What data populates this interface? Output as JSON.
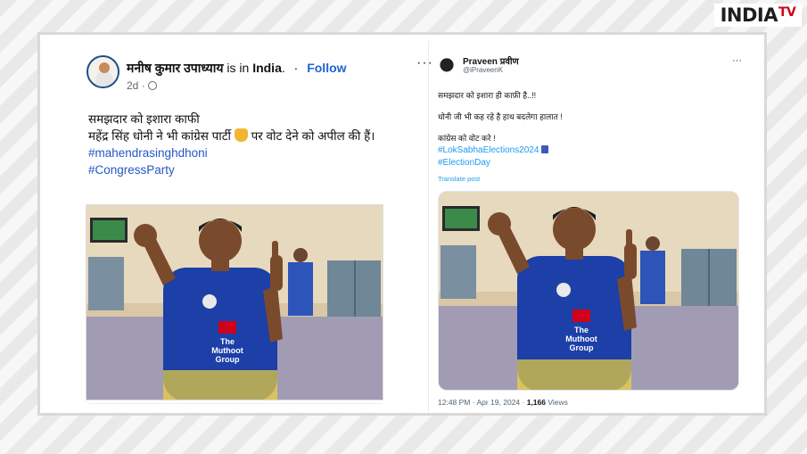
{
  "logo": {
    "main": "INDIA",
    "sub": "TV"
  },
  "facebook_post": {
    "author": "मनीष कुमार उपाध्याय",
    "location_text": "is in",
    "location": "India",
    "separator": "·",
    "follow_label": "Follow",
    "more_label": "···",
    "time": "2d",
    "privacy_icon": "globe-icon",
    "text_line1": "समझदार को इशारा काफी",
    "text_line2_a": "महेंद्र सिंह धोनी ने भी कांग्रेस पार्टी",
    "text_line2_b": "पर वोट देने को अपील की हैं।",
    "hashtags": [
      "#mahendrasinghdhoni",
      "#CongressParty"
    ]
  },
  "x_post": {
    "name": "Praveen प्रवीण",
    "handle": "@iPraveenK",
    "more_label": "···",
    "line1": "समझदार को इशारा ही काफ़ी है..!!",
    "line2": "धोनी जी भी कह रहे है हाथ बदलेगा हालात !",
    "line3": "कांग्रेस को वोट करे !",
    "hashtags": [
      "#LokSabhaElections2024",
      "#ElectionDay"
    ],
    "translate_label": "Translate post",
    "timestamp": "12:48 PM · Apr 19, 2024 ·",
    "views_count": "1,166",
    "views_label": "Views"
  },
  "photo_jersey_lines": [
    "The",
    "Muthoot",
    "Group"
  ],
  "colors": {
    "facebook_link": "#1b64d6",
    "x_link": "#1d9bf0",
    "jersey_blue": "#1c3fa8",
    "jersey_yellow": "#f0d43a"
  }
}
